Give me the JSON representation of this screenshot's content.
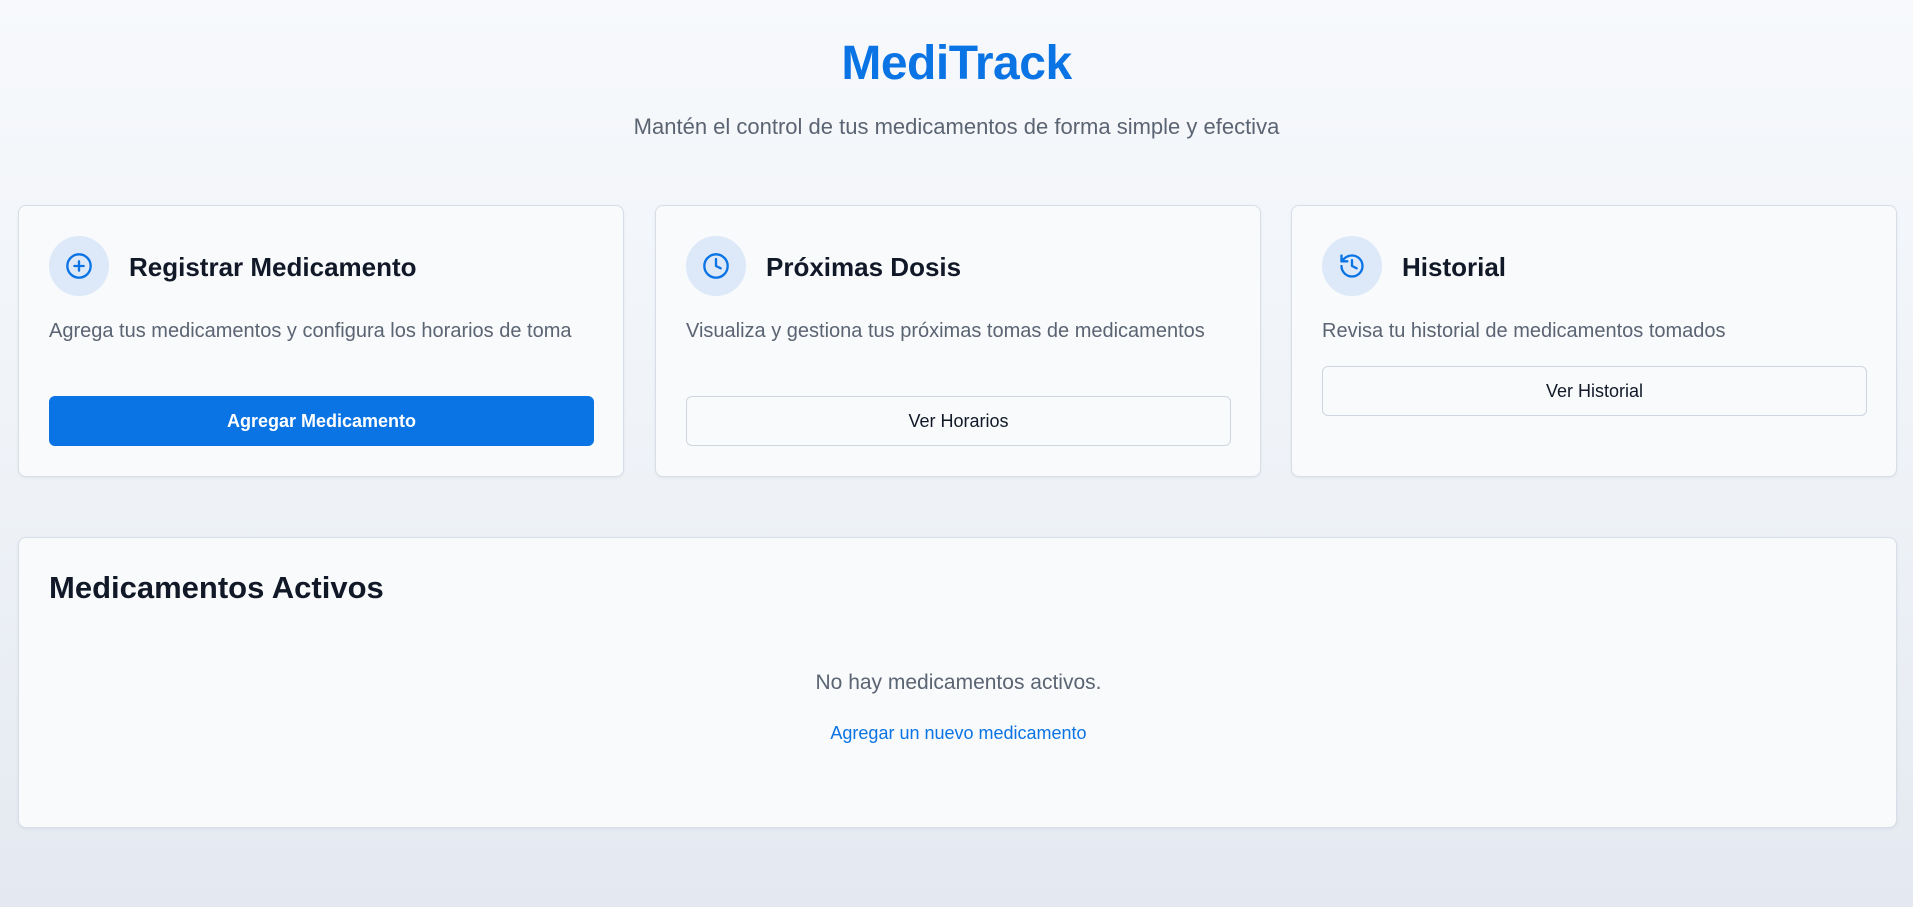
{
  "header": {
    "title": "MediTrack",
    "subtitle": "Mantén el control de tus medicamentos de forma simple y efectiva"
  },
  "cards": [
    {
      "icon": "plus-circle-icon",
      "title": "Registrar Medicamento",
      "description": "Agrega tus medicamentos y configura los horarios de toma",
      "button_label": "Agregar Medicamento"
    },
    {
      "icon": "clock-icon",
      "title": "Próximas Dosis",
      "description": "Visualiza y gestiona tus próximas tomas de medicamentos",
      "button_label": "Ver Horarios"
    },
    {
      "icon": "history-icon",
      "title": "Historial",
      "description": "Revisa tu historial de medicamentos tomados",
      "button_label": "Ver Historial"
    }
  ],
  "active_section": {
    "title": "Medicamentos Activos",
    "empty_message": "No hay medicamentos activos.",
    "add_link": "Agregar un nuevo medicamento"
  },
  "colors": {
    "accent": "#0b74e5",
    "icon_background": "#dde9f8",
    "muted_text": "#5b6472",
    "heading_text": "#111827"
  }
}
